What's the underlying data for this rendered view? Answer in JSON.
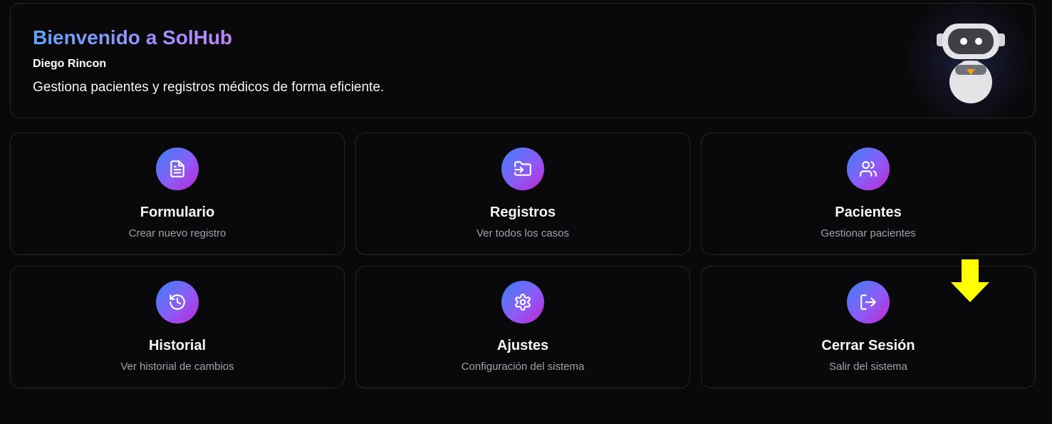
{
  "header": {
    "title": "Bienvenido a SolHub",
    "user_name": "Diego Rincon",
    "description": "Gestiona pacientes y registros médicos de forma eficiente.",
    "mascot": "robot-mascot"
  },
  "cards": [
    {
      "title": "Formulario",
      "subtitle": "Crear nuevo registro",
      "icon": "file-text-icon"
    },
    {
      "title": "Registros",
      "subtitle": "Ver todos los casos",
      "icon": "folder-input-icon"
    },
    {
      "title": "Pacientes",
      "subtitle": "Gestionar pacientes",
      "icon": "users-icon"
    },
    {
      "title": "Historial",
      "subtitle": "Ver historial de cambios",
      "icon": "history-icon"
    },
    {
      "title": "Ajustes",
      "subtitle": "Configuración del sistema",
      "icon": "settings-icon"
    },
    {
      "title": "Cerrar Sesión",
      "subtitle": "Salir del sistema",
      "icon": "log-out-icon"
    }
  ],
  "annotation": {
    "icon": "arrow-down-icon",
    "color": "#ffff00"
  },
  "colors": {
    "background": "#09090b",
    "border": "#27272a",
    "gradient_start": "#3b82f6",
    "gradient_end": "#c026d3",
    "title_gradient_start": "#60a5fa",
    "title_gradient_end": "#c084fc",
    "subtitle": "#a1a1aa"
  }
}
